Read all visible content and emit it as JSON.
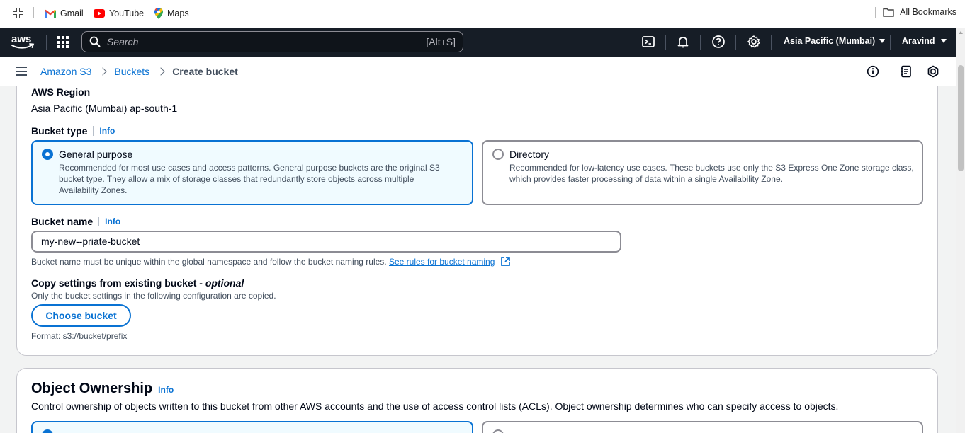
{
  "bookmarks": {
    "items": [
      {
        "label": "Gmail",
        "icon": "gmail-icon"
      },
      {
        "label": "YouTube",
        "icon": "youtube-icon"
      },
      {
        "label": "Maps",
        "icon": "maps-icon"
      }
    ],
    "all_bookmarks": "All Bookmarks"
  },
  "topnav": {
    "logo": "aws",
    "search_placeholder": "Search",
    "search_shortcut": "[Alt+S]",
    "region": "Asia Pacific (Mumbai)",
    "user": "Aravind"
  },
  "breadcrumb": {
    "items": [
      "Amazon S3",
      "Buckets"
    ],
    "current": "Create bucket"
  },
  "general": {
    "region_label": "AWS Region",
    "region_value": "Asia Pacific (Mumbai) ap-south-1",
    "bucket_type_label": "Bucket type",
    "info": "Info",
    "bucket_types": [
      {
        "title": "General purpose",
        "desc_lines": [
          "Recommended for most use cases and access patterns. General purpose buckets are the original S3",
          "bucket type. They allow a mix of storage classes that redundantly store objects across multiple",
          "Availability Zones."
        ],
        "selected": true
      },
      {
        "title": "Directory",
        "desc_lines": [
          "Recommended for low-latency use cases. These buckets use only the S3 Express One Zone storage class,",
          "which provides faster processing of data within a single Availability Zone."
        ],
        "selected": false
      }
    ],
    "bucket_name_label": "Bucket name",
    "bucket_name_value": "my-new--priate-bucket",
    "bucket_name_hint": "Bucket name must be unique within the global namespace and follow the bucket naming rules.",
    "bucket_name_rules_link": "See rules for bucket naming",
    "copy_label": "Copy settings from existing bucket - ",
    "copy_optional": "optional",
    "copy_desc": "Only the bucket settings in the following configuration are copied.",
    "choose_bucket": "Choose bucket",
    "format_hint": "Format: s3://bucket/prefix"
  },
  "ownership": {
    "title": "Object Ownership",
    "info": "Info",
    "desc": "Control ownership of objects written to this bucket from other AWS accounts and the use of access control lists (ACLs). Object ownership determines who can specify access to objects."
  },
  "colors": {
    "nav_bg": "#161d26",
    "link": "#0972d3",
    "selected_tile_bg": "#f0fbff",
    "page_bg": "#f2f3f3"
  }
}
